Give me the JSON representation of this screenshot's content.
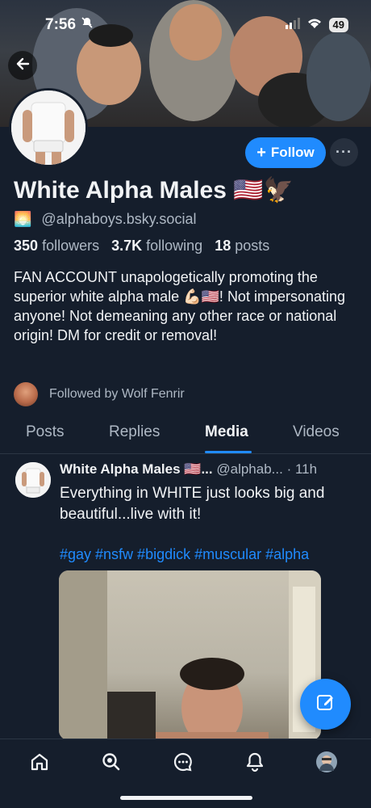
{
  "status_bar": {
    "time": "7:56",
    "battery": "49"
  },
  "profile": {
    "display_name": "White Alpha Males 🇺🇸🦅",
    "handle_emoji": "🌅",
    "handle": "@alphaboys.bsky.social",
    "followers_count": "350",
    "followers_label": "followers",
    "following_count": "3.7K",
    "following_label": "following",
    "posts_count": "18",
    "posts_label": "posts",
    "bio": "FAN ACCOUNT unapologetically promoting the superior white alpha male 💪🏻🇺🇸! Not impersonating anyone! Not demeaning any other race or national origin! DM for credit or removal!",
    "followed_by": "Followed by Wolf Fenrir"
  },
  "actions": {
    "follow_label": "Follow",
    "more_label": "···"
  },
  "tabs": [
    {
      "label": "Posts",
      "active": false
    },
    {
      "label": "Replies",
      "active": false
    },
    {
      "label": "Media",
      "active": true
    },
    {
      "label": "Videos",
      "active": false
    }
  ],
  "post": {
    "author": "White Alpha Males 🇺🇸...",
    "handle": "@alphab...",
    "time": "· 11h",
    "text": "Everything in WHITE just looks big and beautiful...live with it!",
    "hashtags": "#gay #nsfw #bigdick #muscular #alpha"
  },
  "colors": {
    "accent": "#208bfe",
    "background": "#151e2c",
    "muted": "#aeb8c4"
  },
  "nav": [
    "home-icon",
    "search-icon",
    "chat-icon",
    "bell-icon",
    "profile-avatar"
  ]
}
